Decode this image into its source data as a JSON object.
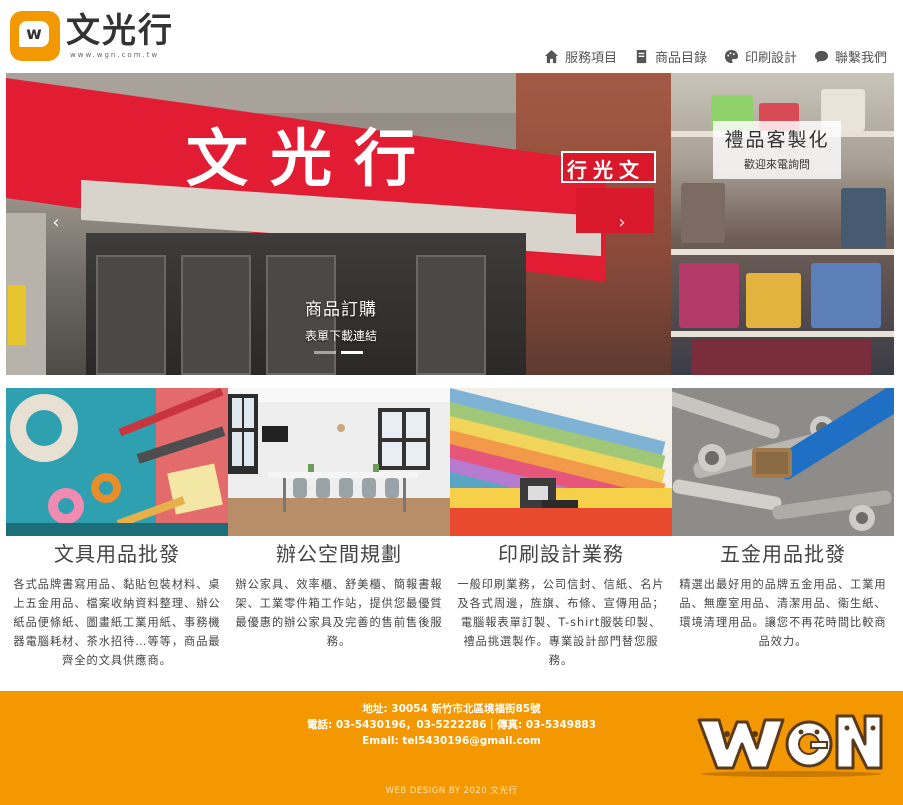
{
  "header": {
    "logo_letter": "w",
    "brand_name": "文光行",
    "brand_url": "www.wgn.com.tw"
  },
  "nav": [
    {
      "label": "服務項目",
      "icon": "home-icon"
    },
    {
      "label": "商品目錄",
      "icon": "book-icon"
    },
    {
      "label": "印刷設計",
      "icon": "palette-icon"
    },
    {
      "label": "聯繫我們",
      "icon": "chat-icon"
    }
  ],
  "hero": {
    "storefront_sign": "文光行",
    "side_sign": "行光文",
    "slide_caption_title": "商品訂購",
    "slide_caption_sub": "表單下載連結",
    "gift_caption_title": "禮品客製化",
    "gift_caption_sub": "歡迎來電詢問",
    "prev_arrow": "‹",
    "next_arrow": "›",
    "slide_count": 2,
    "active_slide": 2
  },
  "cards": [
    {
      "title": "文具用品批發",
      "description": "各式品牌書寫用品、黏貼包裝材料、桌上五金用品、檔案收納資料整理、辦公紙品便條紙、圖畫紙工業用紙、事務機器電腦耗材、茶水招待…等等，商品最齊全的文具供應商。"
    },
    {
      "title": "辦公空間規劃",
      "description": "辦公家具、效率櫃、舒美櫃、簡報書報架、工業零件箱工作站，提供您最優質最優惠的辦公家具及完善的售前售後服務。"
    },
    {
      "title": "印刷設計業務",
      "description": "一般印刷業務，公司信封、信紙、名片及各式周邊，旌旗、布條、宣傳用品；電腦報表單訂製、T-shirt服裝印製、禮品挑選製作。專業設計部門替您服務。"
    },
    {
      "title": "五金用品批發",
      "description": "精選出最好用的品牌五金用品、工業用品、無塵室用品、清潔用品、衛生紙、環境清理用品。讓您不再花時間比較商品效力。"
    }
  ],
  "footer": {
    "address": "地址: 30054 新竹市北區境福街85號",
    "phone": "電話: 03-5430196，03-5222286｜傳真: 03-5349883",
    "email": "Email: tel5430196@gmail.com",
    "credit": "WEB DESIGN BY 2020 文光行",
    "mascot_letters": "WGN"
  },
  "colors": {
    "brand_orange": "#f39800",
    "sign_red": "#e21d33"
  }
}
